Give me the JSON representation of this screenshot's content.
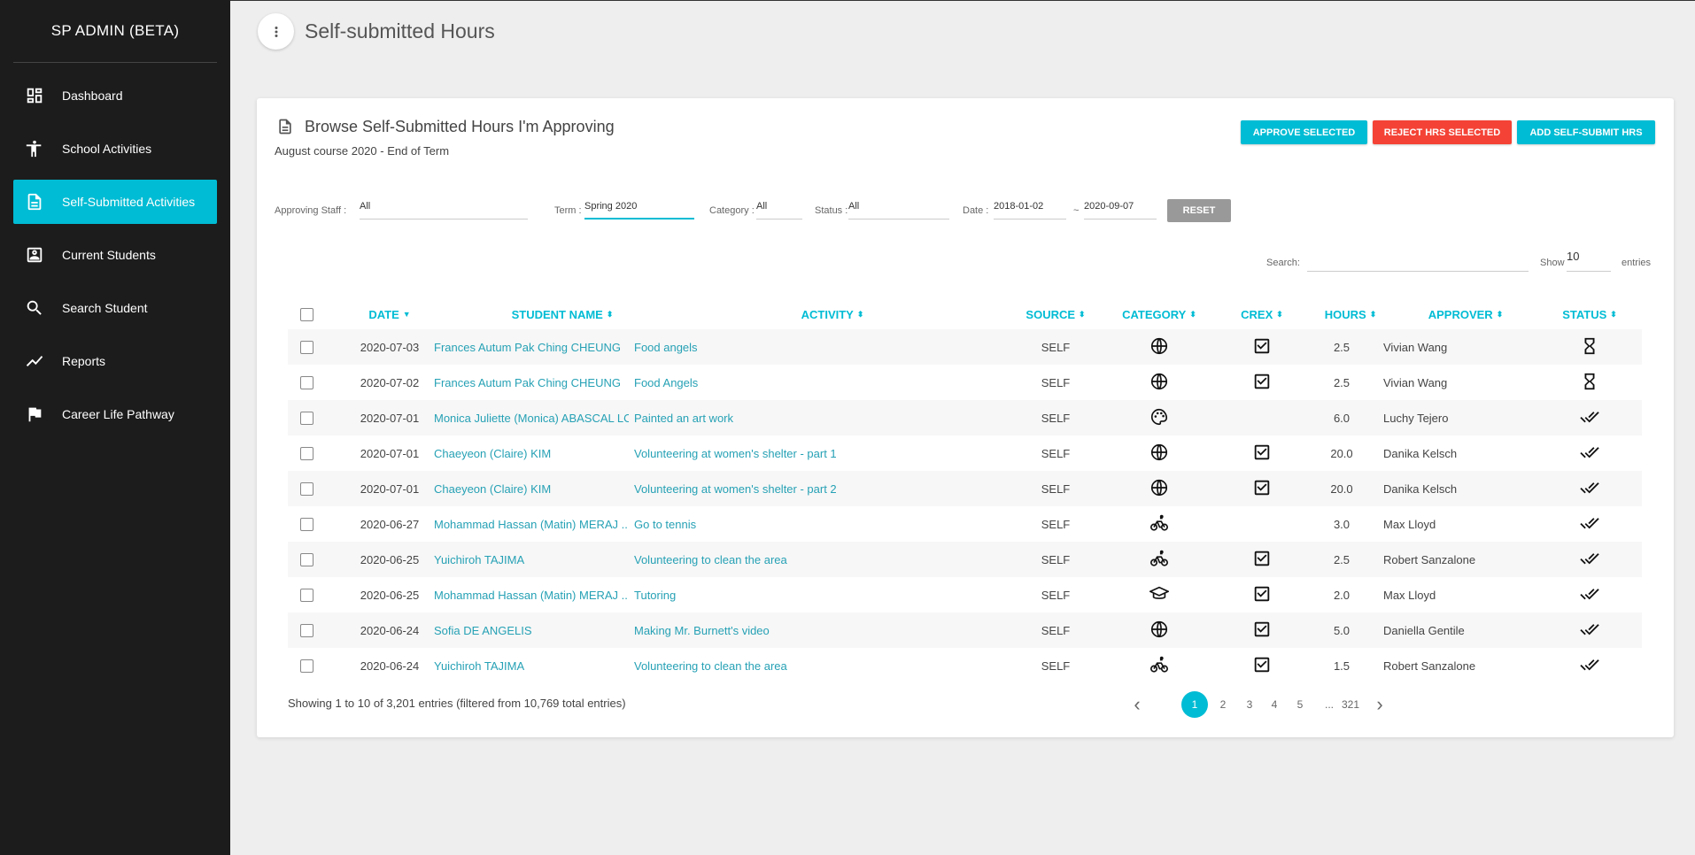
{
  "app": {
    "brand": "SP ADMIN (BETA)"
  },
  "sidebar": {
    "items": [
      {
        "label": "Dashboard",
        "icon": "dashboard-icon"
      },
      {
        "label": "School Activities",
        "icon": "accessibility-icon"
      },
      {
        "label": "Self-Submitted Activities",
        "icon": "document-icon",
        "active": true
      },
      {
        "label": "Current Students",
        "icon": "contact-card-icon"
      },
      {
        "label": "Search Student",
        "icon": "search-icon"
      },
      {
        "label": "Reports",
        "icon": "trending-line-icon"
      },
      {
        "label": "Career Life Pathway",
        "icon": "flag-icon"
      }
    ]
  },
  "page": {
    "title": "Self-submitted Hours"
  },
  "card": {
    "title": "Browse Self-Submitted Hours I'm Approving",
    "subtitle": "August course 2020 - End of Term",
    "buttons": {
      "approve": "APPROVE SELECTED",
      "reject": "REJECT HRS SELECTED",
      "add": "ADD SELF-SUBMIT HRS"
    }
  },
  "filters": {
    "approving_staff_label": "Approving Staff :",
    "approving_staff_value": "All",
    "term_label": "Term :",
    "term_value": "Spring 2020",
    "category_label": "Category :",
    "category_value": "All",
    "status_label": "Status :",
    "status_value": "All",
    "date_label": "Date :",
    "date_from": "2018-01-02",
    "date_sep": "~",
    "date_to": "2020-09-07",
    "reset": "RESET"
  },
  "table_controls": {
    "search_label": "Search:",
    "show_label": "Show",
    "show_value": "10",
    "entries_label": "entries"
  },
  "table": {
    "columns": {
      "date": "DATE",
      "student": "STUDENT NAME",
      "activity": "ACTIVITY",
      "source": "SOURCE",
      "category": "CATEGORY",
      "crex": "CREX",
      "hours": "HOURS",
      "approver": "APPROVER",
      "status": "STATUS"
    },
    "rows": [
      {
        "date": "2020-07-03",
        "student": "Frances Autum Pak Ching CHEUNG",
        "activity": "Food angels",
        "source": "SELF",
        "category": "globe-icon",
        "crex": true,
        "hours": "2.5",
        "approver": "Vivian Wang",
        "status": "hourglass-icon"
      },
      {
        "date": "2020-07-02",
        "student": "Frances Autum Pak Ching CHEUNG",
        "activity": "Food Angels",
        "source": "SELF",
        "category": "globe-icon",
        "crex": true,
        "hours": "2.5",
        "approver": "Vivian Wang",
        "status": "hourglass-icon"
      },
      {
        "date": "2020-07-01",
        "student": "Monica Juliette (Monica) ABASCAL LO...",
        "activity": "Painted an art work",
        "source": "SELF",
        "category": "palette-icon",
        "crex": false,
        "hours": "6.0",
        "approver": "Luchy Tejero",
        "status": "double-check-icon"
      },
      {
        "date": "2020-07-01",
        "student": "Chaeyeon (Claire) KIM",
        "activity": "Volunteering at women's shelter - part 1",
        "source": "SELF",
        "category": "globe-icon",
        "crex": true,
        "hours": "20.0",
        "approver": "Danika Kelsch",
        "status": "double-check-icon"
      },
      {
        "date": "2020-07-01",
        "student": "Chaeyeon (Claire) KIM",
        "activity": "Volunteering at women's shelter - part 2",
        "source": "SELF",
        "category": "globe-icon",
        "crex": true,
        "hours": "20.0",
        "approver": "Danika Kelsch",
        "status": "double-check-icon"
      },
      {
        "date": "2020-06-27",
        "student": "Mohammad Hassan (Matin) MERAJ ...",
        "activity": "Go to tennis",
        "source": "SELF",
        "category": "bike-icon",
        "crex": false,
        "hours": "3.0",
        "approver": "Max Lloyd",
        "status": "double-check-icon"
      },
      {
        "date": "2020-06-25",
        "student": "Yuichiroh TAJIMA",
        "activity": "Volunteering to clean the area",
        "source": "SELF",
        "category": "bike-icon",
        "crex": true,
        "hours": "2.5",
        "approver": "Robert Sanzalone",
        "status": "double-check-icon"
      },
      {
        "date": "2020-06-25",
        "student": "Mohammad Hassan (Matin) MERAJ ...",
        "activity": "Tutoring",
        "source": "SELF",
        "category": "graduation-cap-icon",
        "crex": true,
        "hours": "2.0",
        "approver": "Max Lloyd",
        "status": "double-check-icon"
      },
      {
        "date": "2020-06-24",
        "student": "Sofia DE ANGELIS",
        "activity": "Making Mr. Burnett's video",
        "source": "SELF",
        "category": "globe-icon",
        "crex": true,
        "hours": "5.0",
        "approver": "Daniella Gentile",
        "status": "double-check-icon"
      },
      {
        "date": "2020-06-24",
        "student": "Yuichiroh TAJIMA",
        "activity": "Volunteering to clean the area",
        "source": "SELF",
        "category": "bike-icon",
        "crex": true,
        "hours": "1.5",
        "approver": "Robert Sanzalone",
        "status": "double-check-icon"
      }
    ]
  },
  "footer": {
    "info": "Showing 1 to 10 of 3,201 entries (filtered from 10,769 total entries)",
    "pages": [
      "1",
      "2",
      "3",
      "4",
      "5",
      "...",
      "321"
    ],
    "prev": "‹",
    "next": "›"
  },
  "colors": {
    "accent": "#00bcd4",
    "danger": "#f44336",
    "sidebar": "#1c1c1c"
  }
}
